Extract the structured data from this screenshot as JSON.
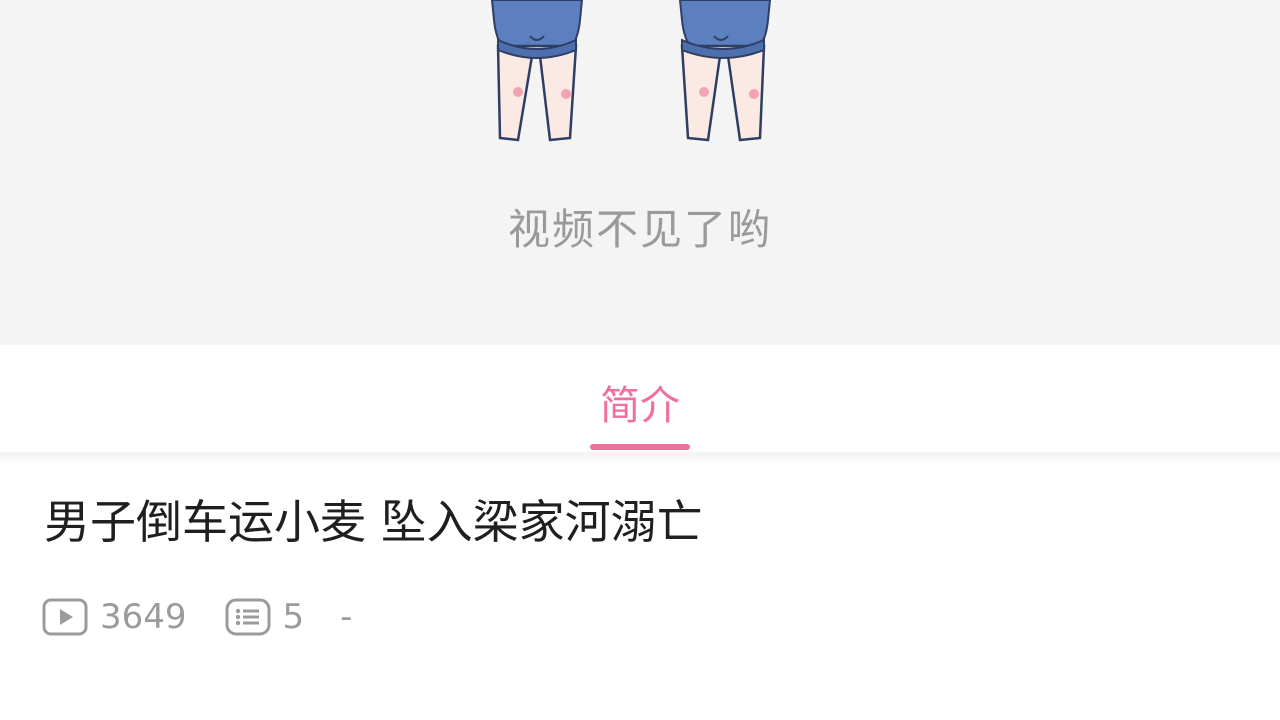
{
  "player": {
    "unavailable_text": "视频不见了哟"
  },
  "tabs": [
    {
      "label": "简介",
      "active": true
    }
  ],
  "video": {
    "title": "男子倒车运小麦 坠入梁家河溺亡",
    "views": "3649",
    "comments": "5",
    "extra": "-"
  },
  "icons": {
    "views": "play-count-icon",
    "comments": "comment-count-icon"
  },
  "colors": {
    "accent": "#f0709a",
    "placeholder_bg": "#f4f4f4",
    "muted_text": "#9b9b9b",
    "title_text": "#1f1f1f"
  }
}
